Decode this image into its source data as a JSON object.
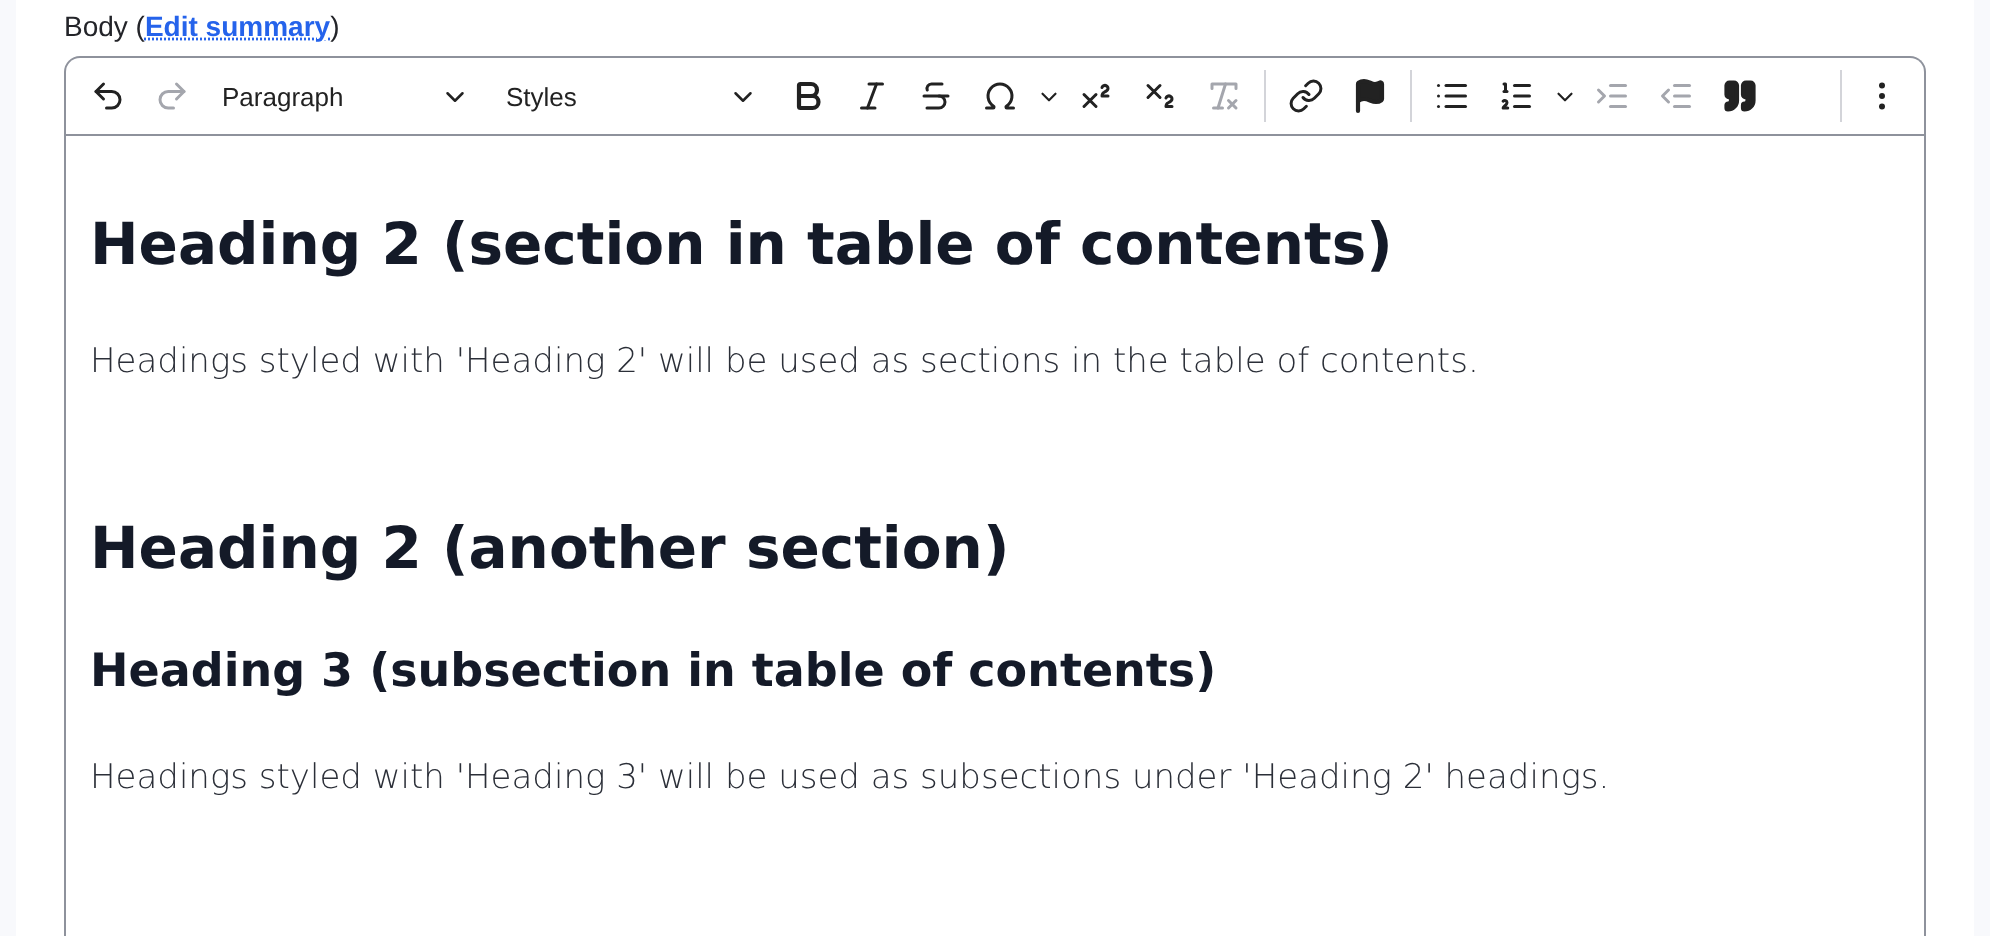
{
  "field": {
    "label": "Body (",
    "link": "Edit summary",
    "suffix": ")"
  },
  "toolbar": {
    "history": [
      {
        "disabled": false
      },
      {
        "disabled": true
      }
    ],
    "dropdowns": [
      {
        "value": "Paragraph"
      },
      {
        "value": "Styles"
      }
    ],
    "buttons": [
      {
        "disabled": false
      },
      {
        "disabled": false
      },
      {
        "disabled": false
      },
      {
        "disabled": false
      },
      {
        "disabled": false
      },
      {
        "disabled": false
      },
      {
        "disabled": true
      },
      {
        "disabled": false
      },
      {
        "disabled": false
      },
      {
        "disabled": false
      },
      {
        "disabled": false
      },
      {
        "disabled": true
      },
      {
        "disabled": true
      },
      {
        "disabled": false
      },
      {
        "disabled": false
      }
    ]
  },
  "content": [
    {
      "kind": "h2",
      "text": "Heading 2 (section in table of contents)"
    },
    {
      "kind": "p",
      "text": "Headings styled with 'Heading 2' will be used as sections in the table of contents."
    },
    {
      "kind": "h2",
      "text": "Heading 2 (another section)"
    },
    {
      "kind": "h3",
      "text": "Heading 3 (subsection in table of contents)"
    },
    {
      "kind": "p",
      "text": "Headings styled with 'Heading 3' will be used as subsections under 'Heading 2' headings."
    }
  ]
}
